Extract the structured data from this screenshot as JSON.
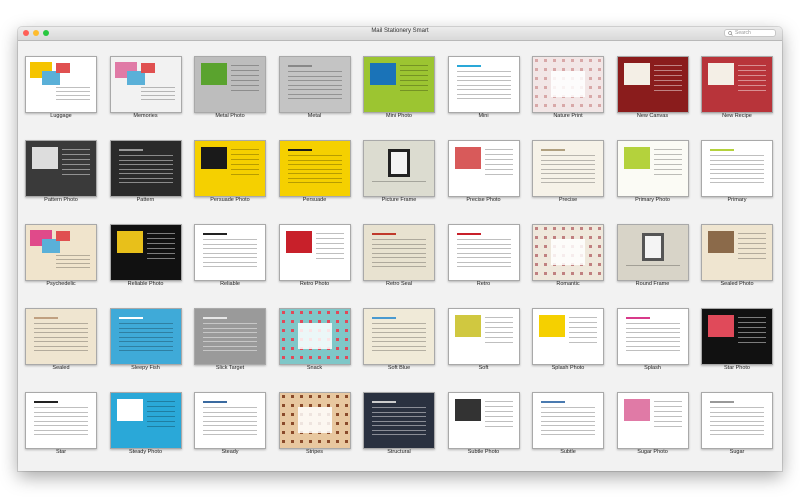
{
  "window": {
    "title": "Mail Stationery Smart",
    "search_placeholder": "Search",
    "traffic_lights": [
      "#ff5f57",
      "#febc2e",
      "#28c840"
    ]
  },
  "templates": [
    {
      "name": "Luggage",
      "bg": "#ffffff",
      "accent": "#f5c400",
      "style": "collage"
    },
    {
      "name": "Memories",
      "bg": "#f2f2f2",
      "accent": "#e07aa6",
      "style": "collage"
    },
    {
      "name": "Metal Photo",
      "bg": "#bdbdbd",
      "accent": "#5aa32e",
      "style": "photo"
    },
    {
      "name": "Metal",
      "bg": "#c4c4c4",
      "accent": "#888888",
      "style": "text"
    },
    {
      "name": "Mini Photo",
      "bg": "#9cc531",
      "accent": "#1a73b8",
      "style": "photo"
    },
    {
      "name": "Mini",
      "bg": "#ffffff",
      "accent": "#2aa8d8",
      "style": "text"
    },
    {
      "name": "Nature Print",
      "bg": "#f2e6e6",
      "accent": "#d8a8a8",
      "style": "pattern"
    },
    {
      "name": "New Canvas",
      "bg": "#8a1c1c",
      "accent": "#f4efe6",
      "style": "photo"
    },
    {
      "name": "New Recipe",
      "bg": "#b8343a",
      "accent": "#f4efe6",
      "style": "photo"
    },
    {
      "name": "Pattern Photo",
      "bg": "#3a3a3a",
      "accent": "#dddddd",
      "style": "photo"
    },
    {
      "name": "Pattern",
      "bg": "#2a2a2a",
      "accent": "#999999",
      "style": "text"
    },
    {
      "name": "Persuade Photo",
      "bg": "#f5d000",
      "accent": "#1a1a1a",
      "style": "photo"
    },
    {
      "name": "Persuade",
      "bg": "#f5d000",
      "accent": "#1a1a1a",
      "style": "text"
    },
    {
      "name": "Picture Frame",
      "bg": "#dcdcd0",
      "accent": "#222222",
      "style": "frame"
    },
    {
      "name": "Precise Photo",
      "bg": "#ffffff",
      "accent": "#d85a5a",
      "style": "photo"
    },
    {
      "name": "Precise",
      "bg": "#f6f2e8",
      "accent": "#b0a080",
      "style": "text"
    },
    {
      "name": "Primary Photo",
      "bg": "#fbfbf5",
      "accent": "#b4d23c",
      "style": "photo"
    },
    {
      "name": "Primary",
      "bg": "#ffffff",
      "accent": "#b4d23c",
      "style": "text"
    },
    {
      "name": "Psychedelic",
      "bg": "#f0e4cc",
      "accent": "#e04a8a",
      "style": "collage"
    },
    {
      "name": "Reliable Photo",
      "bg": "#111111",
      "accent": "#e8c01a",
      "style": "photo"
    },
    {
      "name": "Reliable",
      "bg": "#ffffff",
      "accent": "#222222",
      "style": "text"
    },
    {
      "name": "Retro Photo",
      "bg": "#ffffff",
      "accent": "#c8202a",
      "style": "photo"
    },
    {
      "name": "Retro Seal",
      "bg": "#e8e2d0",
      "accent": "#c0392b",
      "style": "text"
    },
    {
      "name": "Retro",
      "bg": "#ffffff",
      "accent": "#c8202a",
      "style": "text"
    },
    {
      "name": "Romantic",
      "bg": "#efe8dc",
      "accent": "#c08080",
      "style": "pattern"
    },
    {
      "name": "Round Frame",
      "bg": "#d8d4c8",
      "accent": "#555555",
      "style": "frame"
    },
    {
      "name": "Sealed Photo",
      "bg": "#efe5d0",
      "accent": "#8b6a4a",
      "style": "photo"
    },
    {
      "name": "Sealed",
      "bg": "#efe5d0",
      "accent": "#c0a080",
      "style": "text"
    },
    {
      "name": "Sleepy Fish",
      "bg": "#3faad8",
      "accent": "#ffffff",
      "style": "text"
    },
    {
      "name": "Slick Target",
      "bg": "#9a9a9a",
      "accent": "#e6e6e6",
      "style": "text"
    },
    {
      "name": "Snack",
      "bg": "#7fc7c8",
      "accent": "#e04a5a",
      "style": "pattern"
    },
    {
      "name": "Soft Blue",
      "bg": "#f0ead8",
      "accent": "#4a9ad0",
      "style": "text"
    },
    {
      "name": "Soft",
      "bg": "#ffffff",
      "accent": "#d0c840",
      "style": "photo"
    },
    {
      "name": "Splash Photo",
      "bg": "#ffffff",
      "accent": "#f5d000",
      "style": "photo"
    },
    {
      "name": "Splash",
      "bg": "#ffffff",
      "accent": "#d83a8a",
      "style": "text"
    },
    {
      "name": "Star Photo",
      "bg": "#111111",
      "accent": "#e04a5a",
      "style": "photo"
    },
    {
      "name": "Star",
      "bg": "#ffffff",
      "accent": "#222222",
      "style": "text"
    },
    {
      "name": "Steady Photo",
      "bg": "#2aa8d8",
      "accent": "#ffffff",
      "style": "photo"
    },
    {
      "name": "Steady",
      "bg": "#ffffff",
      "accent": "#3a6aa0",
      "style": "text"
    },
    {
      "name": "Stripes",
      "bg": "#e8c8a0",
      "accent": "#8a4a2a",
      "style": "pattern"
    },
    {
      "name": "Structural",
      "bg": "#2a3140",
      "accent": "#cccccc",
      "style": "text"
    },
    {
      "name": "Subtle Photo",
      "bg": "#ffffff",
      "accent": "#333333",
      "style": "photo"
    },
    {
      "name": "Subtle",
      "bg": "#ffffff",
      "accent": "#4a7ab0",
      "style": "text"
    },
    {
      "name": "Sugar Photo",
      "bg": "#ffffff",
      "accent": "#e07aa6",
      "style": "photo"
    },
    {
      "name": "Sugar",
      "bg": "#ffffff",
      "accent": "#999999",
      "style": "text"
    }
  ]
}
